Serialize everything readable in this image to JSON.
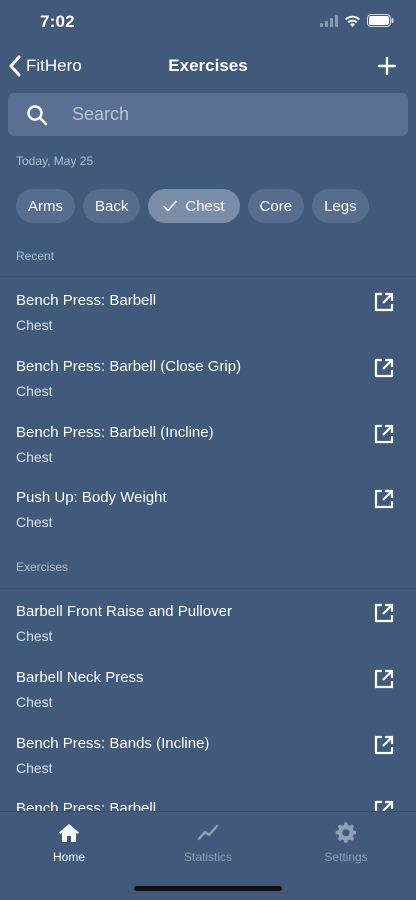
{
  "status": {
    "time": "7:02"
  },
  "nav": {
    "back_label": "FitHero",
    "title": "Exercises"
  },
  "search": {
    "placeholder": "Search"
  },
  "date_label": "Today, May 25",
  "filters": [
    {
      "label": "Arms",
      "selected": false
    },
    {
      "label": "Back",
      "selected": false
    },
    {
      "label": "Chest",
      "selected": true
    },
    {
      "label": "Core",
      "selected": false
    },
    {
      "label": "Legs",
      "selected": false
    }
  ],
  "recent": {
    "header": "Recent",
    "items": [
      {
        "title": "Bench Press: Barbell",
        "category": "Chest"
      },
      {
        "title": "Bench Press: Barbell (Close Grip)",
        "category": "Chest"
      },
      {
        "title": "Bench Press: Barbell (Incline)",
        "category": "Chest"
      },
      {
        "title": "Push Up: Body Weight",
        "category": "Chest"
      }
    ]
  },
  "exercises": {
    "header": "Exercises",
    "items": [
      {
        "title": "Barbell Front Raise and Pullover",
        "category": "Chest"
      },
      {
        "title": "Barbell Neck Press",
        "category": "Chest"
      },
      {
        "title": "Bench Press: Bands (Incline)",
        "category": "Chest"
      },
      {
        "title": "Bench Press: Barbell",
        "category": ""
      }
    ]
  },
  "tabs": [
    {
      "label": "Home",
      "icon": "home-icon",
      "active": true
    },
    {
      "label": "Statistics",
      "icon": "chart-line-icon",
      "active": false
    },
    {
      "label": "Settings",
      "icon": "gear-icon",
      "active": false
    }
  ],
  "colors": {
    "background": "#41597a",
    "chip": "#566d8e",
    "chip_selected": "#7a8ea9",
    "search_bg": "#5a7092"
  }
}
